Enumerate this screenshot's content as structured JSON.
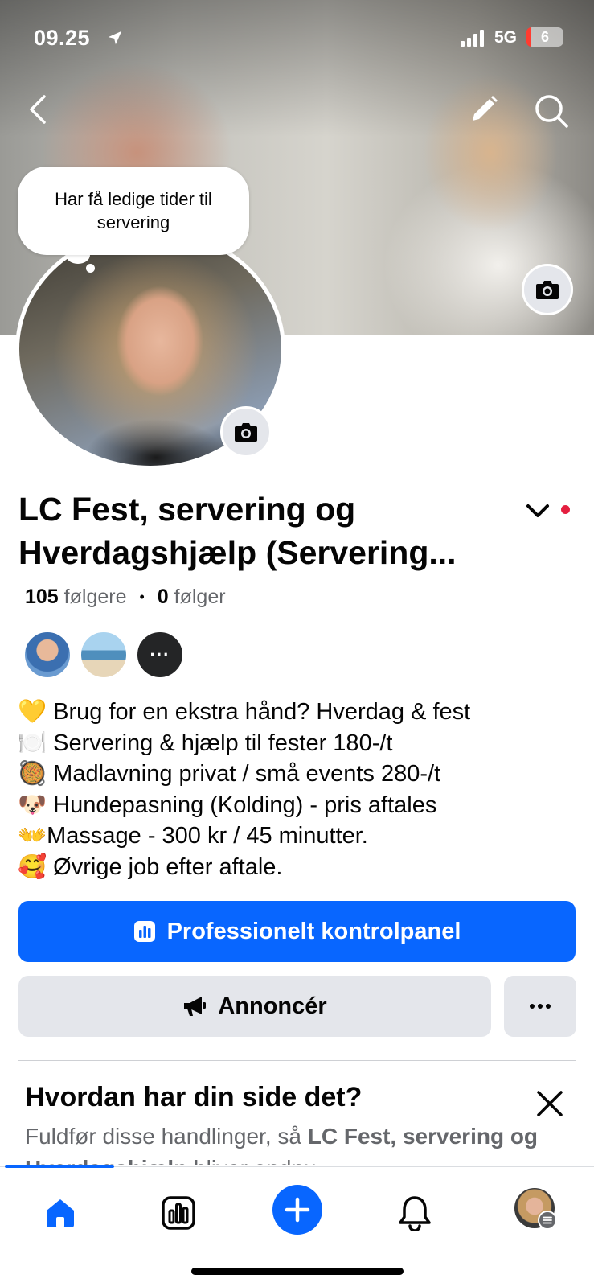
{
  "status_bar": {
    "time": "09.25",
    "network": "5G",
    "battery": "6"
  },
  "cover": {
    "back_icon": "chevron-left-icon",
    "edit_icon": "pencil-icon",
    "search_icon": "search-icon",
    "camera_icon": "camera-icon"
  },
  "profile": {
    "note": "Har få ledige tider til servering",
    "name": "LC Fest, servering og Hverdagshjælp (Servering...",
    "followers_count": "105",
    "followers_label": "følgere",
    "following_count": "0",
    "following_label": "følger",
    "friends_more": "···"
  },
  "bio": [
    {
      "emoji": "💛",
      "text": " Brug for en ekstra hånd? Hverdag & fest"
    },
    {
      "emoji": "🍽️",
      "text": " Servering & hjælp til fester 180-/t"
    },
    {
      "emoji": "🥘",
      "text": " Madlavning privat / små events 280-/t"
    },
    {
      "emoji": "🐶",
      "text": " Hundepasning (Kolding) - pris aftales"
    },
    {
      "emoji": "👐",
      "text": "Massage - 300 kr / 45 minutter."
    },
    {
      "emoji": "🥰",
      "text": " Øvrige job efter aftale."
    }
  ],
  "actions": {
    "dashboard_label": "Professionelt kontrolpanel",
    "advertise_label": "Annoncér",
    "more_label": "···"
  },
  "card": {
    "title": "Hvordan har din side det?",
    "desc_prefix": "Fuldfør disse handlinger, så ",
    "desc_bold": "LC Fest, servering og Hverdagshjælp",
    "desc_suffix": " bliver endnu"
  },
  "colors": {
    "accent": "#0866ff",
    "secondary_button": "#e4e6eb",
    "notification_dot": "#e41e3f",
    "text_secondary": "#65676b"
  }
}
